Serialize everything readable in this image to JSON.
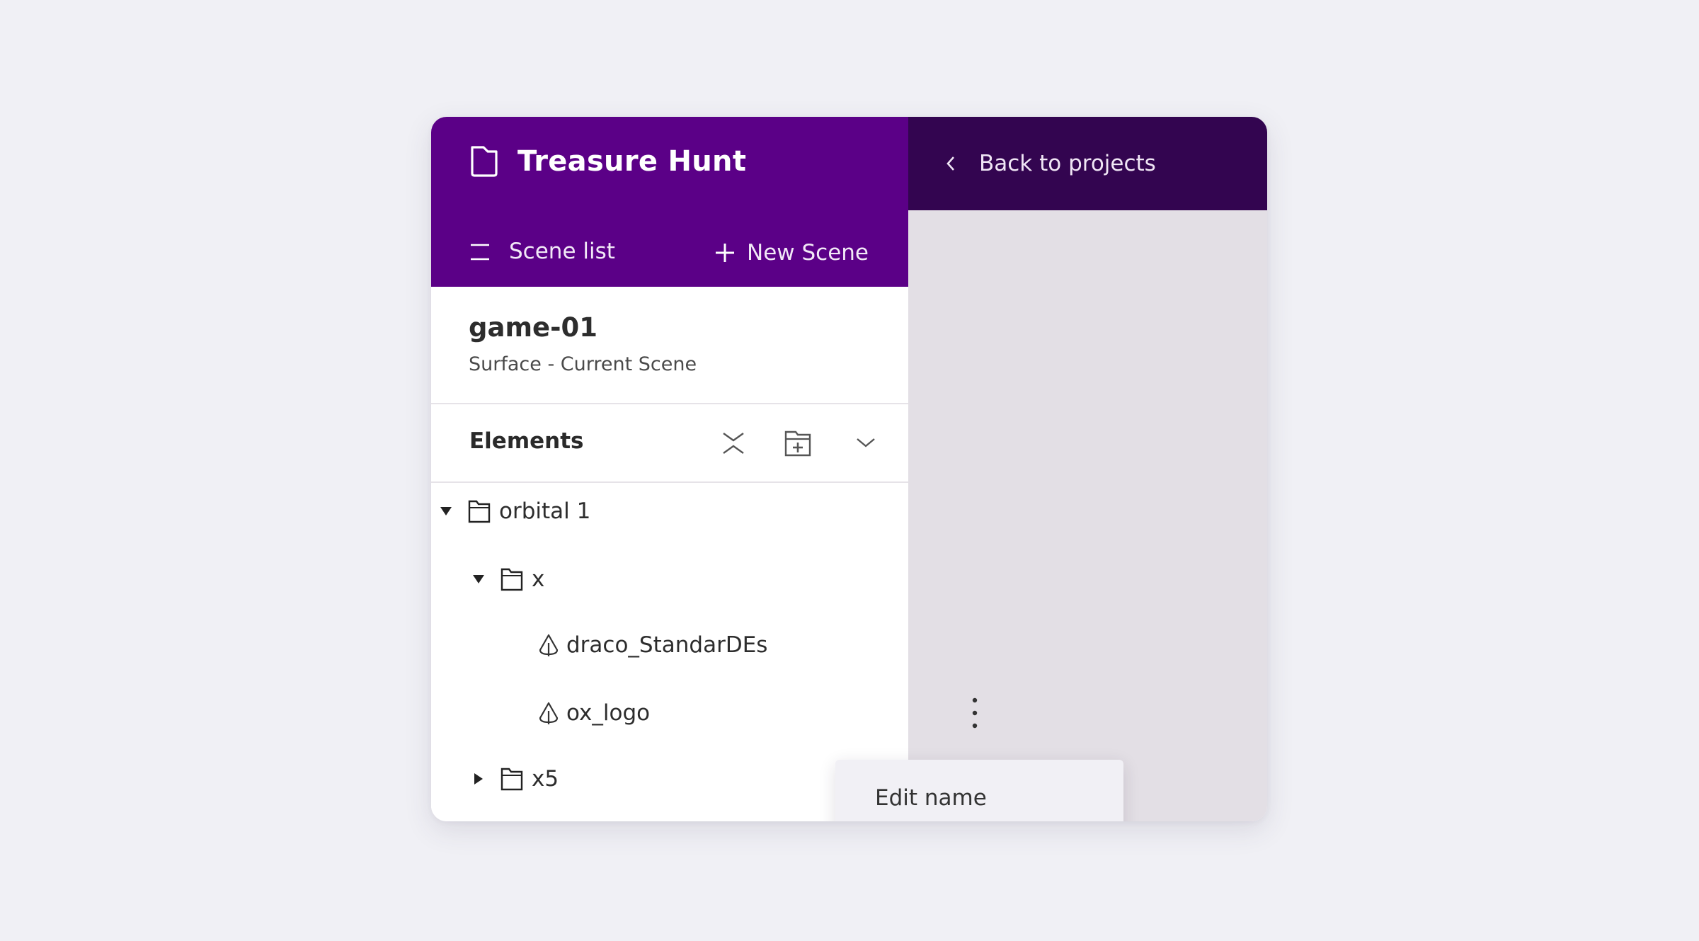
{
  "colors": {
    "page_background": "#f0f0f5",
    "project_header": "#5b0087",
    "top_bar_dark": "#330550",
    "canvas_area": "#e3dfe5",
    "panel_background": "#ffffff",
    "context_menu_background": "#f1f0f5"
  },
  "project": {
    "title": "Treasure Hunt",
    "icon": "folder-icon"
  },
  "scene_toolbar": {
    "scene_list_label": "Scene list",
    "scene_list_icon": "list-icon",
    "new_scene_label": "New Scene",
    "new_scene_icon": "plus-icon"
  },
  "navigation": {
    "back_label": "Back to projects",
    "back_icon": "chevron-left-icon"
  },
  "scene": {
    "name": "game-01",
    "subtitle": "Surface - Current Scene"
  },
  "elements_panel": {
    "title": "Elements",
    "actions": [
      {
        "name": "collapse-all",
        "icon": "collapse-all-icon"
      },
      {
        "name": "new-folder",
        "icon": "folder-plus-icon"
      },
      {
        "name": "expand-options",
        "icon": "chevron-down-icon"
      }
    ],
    "tree": [
      {
        "label": "orbital 1",
        "type": "folder",
        "depth": 0,
        "expanded": true
      },
      {
        "label": "x",
        "type": "folder",
        "depth": 1,
        "expanded": true
      },
      {
        "label": "draco_StandarDEs",
        "type": "mesh",
        "depth": 2
      },
      {
        "label": "ox_logo",
        "type": "mesh",
        "depth": 2,
        "has_menu": true
      },
      {
        "label": "x5",
        "type": "folder",
        "depth": 1,
        "expanded": false
      }
    ]
  },
  "context_menu": {
    "items": [
      {
        "label": "Edit name"
      }
    ]
  }
}
